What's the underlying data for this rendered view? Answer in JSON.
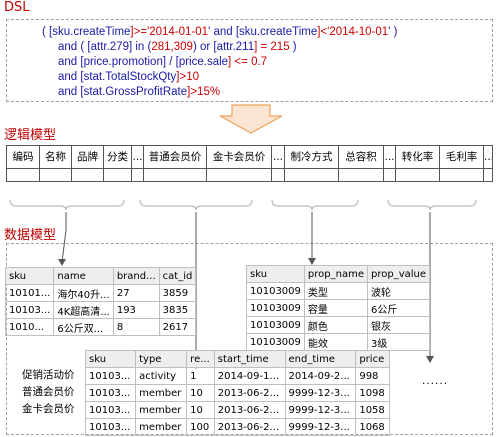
{
  "dsl": {
    "title": "DSL",
    "line1": [
      "( [",
      "sku.createTime",
      "]>='",
      "2014-01-01",
      "' and [",
      "sku.createTime",
      "]<'",
      "2014-10-01",
      "' )"
    ],
    "line2": [
      "and ( [",
      "attr.279",
      "] in (",
      "281,309",
      ") or [",
      "attr.211",
      "] = ",
      "215",
      " )"
    ],
    "line3": [
      "and [",
      "price.promotion",
      "] / [",
      "price.sale",
      "] <= ",
      "0.7"
    ],
    "line4": [
      "and [",
      "stat.TotalStockQty",
      "]>",
      "10"
    ],
    "line5": [
      "and [",
      "stat.GrossProfitRate",
      "]>",
      "15%"
    ]
  },
  "logic": {
    "title": "逻辑模型",
    "headers": [
      "编码",
      "名称",
      "品牌",
      "分类",
      "...",
      "普通会员价",
      "金卡会员价",
      "...",
      "制冷方式",
      "总容积",
      "...",
      "转化率",
      "毛利率",
      "..."
    ]
  },
  "data_model": {
    "title": "数据模型",
    "sku_table": {
      "columns": [
        "sku",
        "name",
        "brand...",
        "cat_id"
      ],
      "rows": [
        [
          "10101...",
          "海尔40升...",
          "27",
          "3859"
        ],
        [
          "10103...",
          "4K超高清...",
          "193",
          "3835"
        ],
        [
          "1010...",
          "6公斤双...",
          "8",
          "2617"
        ]
      ]
    },
    "prop_table": {
      "columns": [
        "sku",
        "prop_name",
        "prop_value"
      ],
      "rows": [
        [
          "10103009",
          "类型",
          "波轮"
        ],
        [
          "10103009",
          "容量",
          "6公斤"
        ],
        [
          "10103009",
          "颜色",
          "银灰"
        ],
        [
          "10103009",
          "能效",
          "3级"
        ]
      ]
    },
    "price_table": {
      "columns": [
        "sku",
        "type",
        "re...",
        "start_time",
        "end_time",
        "price"
      ],
      "rows": [
        [
          "10103...",
          "activity",
          "1",
          "2014-09-1...",
          "2014-09-2...",
          "998"
        ],
        [
          "10103...",
          "member",
          "10",
          "2013-06-2...",
          "9999-12-3...",
          "1098"
        ],
        [
          "10103...",
          "member",
          "10",
          "2013-06-2...",
          "9999-12-3...",
          "1058"
        ],
        [
          "10103...",
          "member",
          "100",
          "2013-06-2...",
          "9999-12-3...",
          "1068"
        ]
      ]
    },
    "price_labels": [
      "促销活动价",
      "普通会员价",
      "金卡会员价"
    ],
    "ellipsis": "......"
  },
  "colors": {
    "title_red": "#c00000",
    "keyword_blue": "#1a1aa6",
    "value_red": "#cc0000",
    "arrow_fill": "#fbe5d2",
    "arrow_stroke": "#f0a05a"
  }
}
